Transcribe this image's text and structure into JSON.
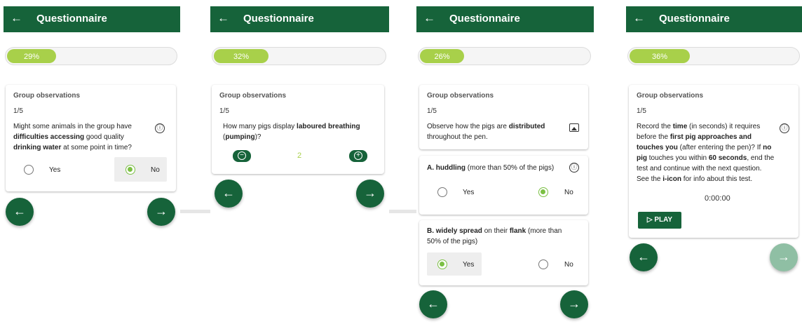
{
  "app": {
    "title": "Questionnaire",
    "back_icon": "←"
  },
  "screens": [
    {
      "progress": {
        "value": 0.29,
        "label": "29%"
      },
      "card": {
        "group": "Group observations",
        "step": "1/5",
        "question": [
          {
            "t": "Might some animals in the group have ",
            "b": false
          },
          {
            "t": "difficulties accessing",
            "b": true
          },
          {
            "t": " good quality ",
            "b": false
          },
          {
            "t": "drinking water",
            "b": true
          },
          {
            "t": " at some point in time?",
            "b": false
          }
        ],
        "info_icon": "ⓘ",
        "options": {
          "yes": "Yes",
          "no": "No",
          "selected": "No"
        }
      },
      "nav": {
        "prev": "←",
        "next": "→"
      }
    },
    {
      "progress": {
        "value": 0.32,
        "label": "32%"
      },
      "card": {
        "group": "Group observations",
        "step": "1/5",
        "question": [
          {
            "t": "How many pigs display ",
            "b": false
          },
          {
            "t": "laboured breathing",
            "b": true
          },
          {
            "t": " (",
            "b": false
          },
          {
            "t": "pumping",
            "b": true
          },
          {
            "t": ")?",
            "b": false
          }
        ],
        "stepper": {
          "value": "2",
          "minus": "−",
          "plus": "+"
        }
      },
      "nav": {
        "prev": "←",
        "next": "→"
      }
    },
    {
      "progress": {
        "value": 0.26,
        "label": "26%"
      },
      "card": {
        "group": "Group observations",
        "step": "1/5",
        "question": [
          {
            "t": "Observe how the pigs are ",
            "b": false
          },
          {
            "t": "distributed",
            "b": true
          },
          {
            "t": " throughout the pen.",
            "b": false
          }
        ],
        "image_icon": "image-icon"
      },
      "sub_a": {
        "question": [
          {
            "t": "A. huddling",
            "b": true
          },
          {
            "t": " (more than 50% of the pigs)",
            "b": false
          }
        ],
        "options": {
          "yes": "Yes",
          "no": "No",
          "selected": "No"
        }
      },
      "sub_b": {
        "question": [
          {
            "t": "B. widely spread",
            "b": true
          },
          {
            "t": " on their ",
            "b": false
          },
          {
            "t": "flank",
            "b": true
          },
          {
            "t": " (more than 50% of the pigs)",
            "b": false
          }
        ],
        "options": {
          "yes": "Yes",
          "no": "No",
          "selected": "Yes"
        }
      },
      "nav": {
        "prev": "←",
        "next": "→"
      }
    },
    {
      "progress": {
        "value": 0.36,
        "label": "36%"
      },
      "card": {
        "group": "Group observations",
        "step": "1/5",
        "question": [
          {
            "t": "Record the ",
            "b": false
          },
          {
            "t": "time",
            "b": true
          },
          {
            "t": " (in seconds) it requires before the ",
            "b": false
          },
          {
            "t": "first pig approaches and touches you",
            "b": true
          },
          {
            "t": " (after entering the pen)? If ",
            "b": false
          },
          {
            "t": "no pig",
            "b": true
          },
          {
            "t": " touches you within ",
            "b": false
          },
          {
            "t": "60 seconds",
            "b": true
          },
          {
            "t": ", end the test and continue with the next question.",
            "b": false
          },
          {
            "t": "\nSee the ",
            "b": false
          },
          {
            "t": "i-icon",
            "b": true
          },
          {
            "t": " for info about this test.",
            "b": false
          }
        ],
        "timer": "0:00:00",
        "play_label": "▷ PLAY"
      },
      "nav": {
        "prev": "←",
        "next": "→",
        "next_disabled": true
      }
    }
  ],
  "colors": {
    "brand": "#16633a",
    "accent": "#a8d04a",
    "radio": "#7bc043"
  }
}
